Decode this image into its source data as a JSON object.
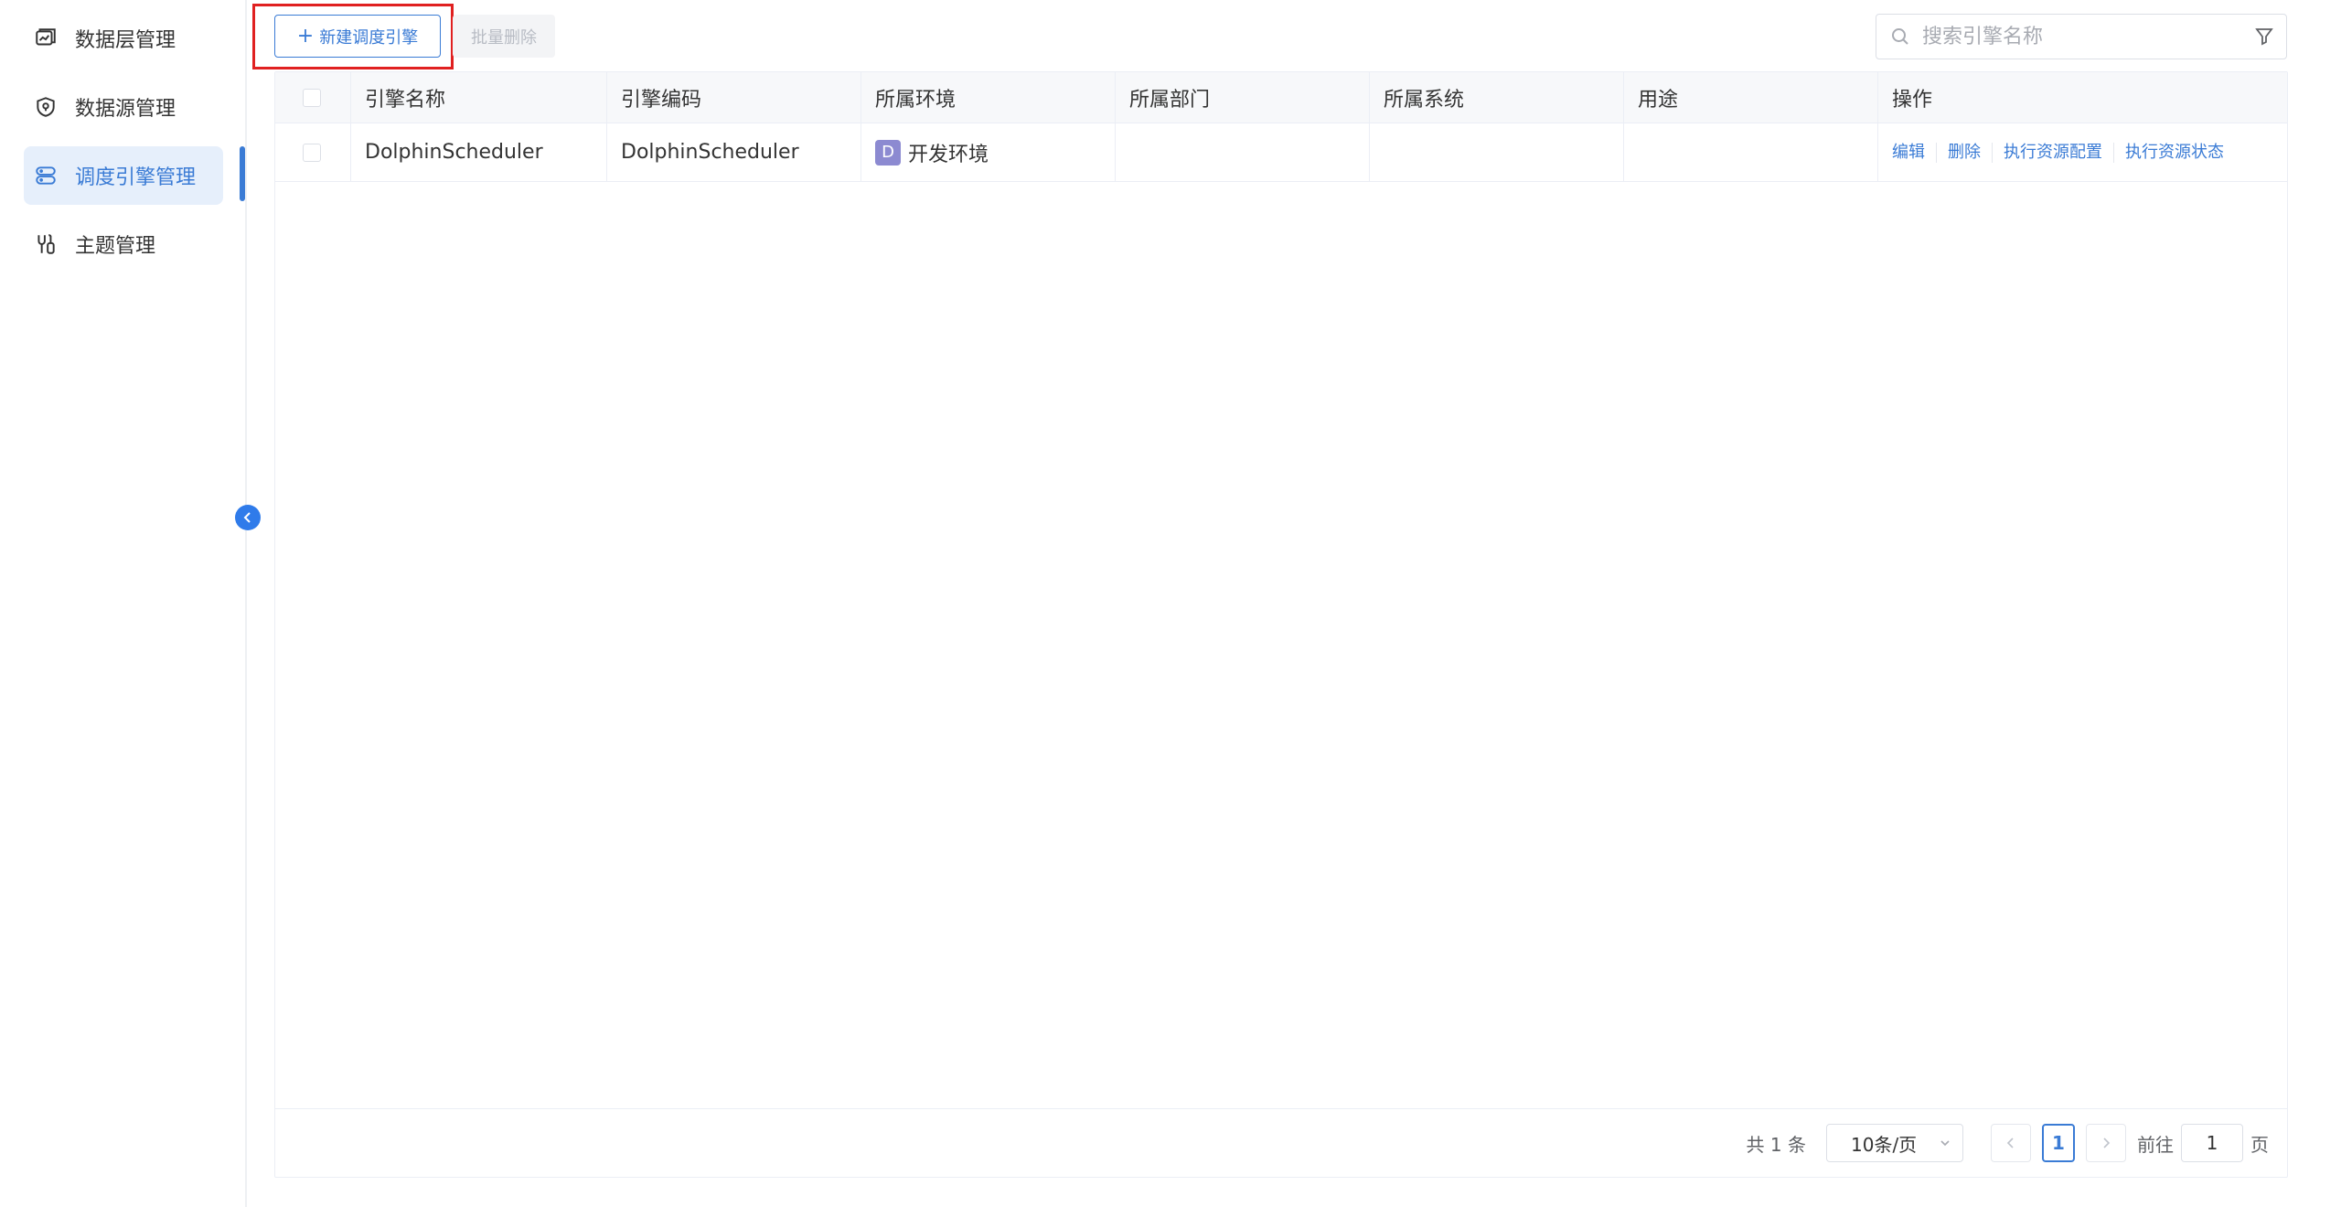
{
  "sidebar": {
    "items": [
      {
        "label": "数据层管理",
        "icon": "layers-icon",
        "active": false
      },
      {
        "label": "数据源管理",
        "icon": "shield-icon",
        "active": false
      },
      {
        "label": "调度引擎管理",
        "icon": "server-icon",
        "active": true
      },
      {
        "label": "主题管理",
        "icon": "tools-icon",
        "active": false
      }
    ]
  },
  "toolbar": {
    "new_label": "新建调度引擎",
    "batch_delete_label": "批量删除"
  },
  "search": {
    "placeholder": "搜索引擎名称",
    "value": ""
  },
  "table": {
    "columns": [
      "引擎名称",
      "引擎编码",
      "所属环境",
      "所属部门",
      "所属系统",
      "用途",
      "操作"
    ],
    "rows": [
      {
        "name": "DolphinScheduler",
        "code": "DolphinScheduler",
        "env_badge": "D",
        "env": "开发环境",
        "department": "",
        "system": "",
        "purpose": "",
        "actions": [
          "编辑",
          "删除",
          "执行资源配置",
          "执行资源状态"
        ]
      }
    ]
  },
  "pagination": {
    "total": "共 1 条",
    "page_size": "10条/页",
    "current_page": "1",
    "goto_label": "前往",
    "goto_value": "1",
    "page_suffix": "页"
  },
  "colors": {
    "accent": "#3a7bd5",
    "highlight": "#e02020",
    "env_badge": "#8c8ad1"
  }
}
